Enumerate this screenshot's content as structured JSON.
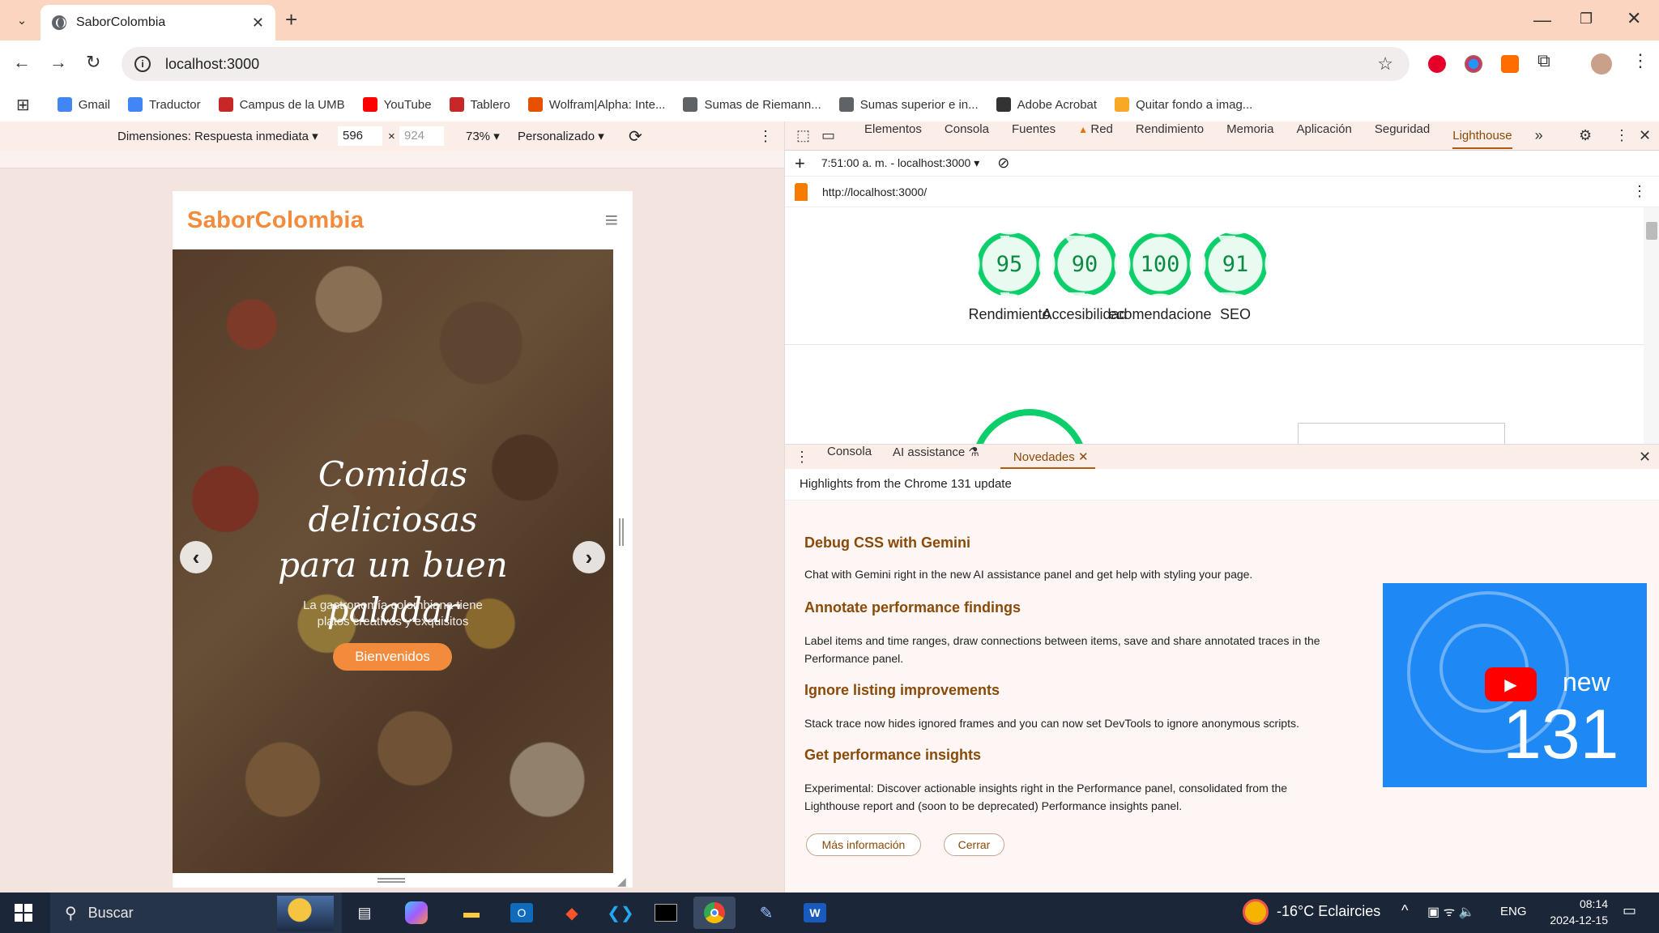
{
  "browser": {
    "tab_title": "SaborColombia",
    "url": "localhost:3000",
    "bookmarks": [
      {
        "label": "Gmail",
        "color": "#4285f4"
      },
      {
        "label": "Traductor",
        "color": "#4285f4"
      },
      {
        "label": "Campus de la UMB",
        "color": "#c62828"
      },
      {
        "label": "YouTube",
        "color": "#ff0000"
      },
      {
        "label": "Tablero",
        "color": "#c62828"
      },
      {
        "label": "Wolfram|Alpha: Inte...",
        "color": "#e65100"
      },
      {
        "label": "Sumas de Riemann...",
        "color": "#5f6368"
      },
      {
        "label": "Sumas superior e in...",
        "color": "#5f6368"
      },
      {
        "label": "Adobe Acrobat",
        "color": "#333333"
      },
      {
        "label": "Quitar fondo a imag...",
        "color": "#f9a825"
      }
    ]
  },
  "device_toolbar": {
    "dimensions_label": "Dimensiones: Respuesta inmediata",
    "width": "596",
    "height": "924",
    "zoom": "73%",
    "throttle": "Personalizado"
  },
  "site": {
    "logo": "SaborColombia",
    "hero_title": "Comidas deliciosas para un buen paladar",
    "hero_subtitle": "La gastronomía colombiana tiene platos creativos y exquisitos",
    "hero_button": "Bienvenidos"
  },
  "devtools": {
    "tabs": [
      "Elementos",
      "Consola",
      "Fuentes",
      "Red",
      "Rendimiento",
      "Memoria",
      "Aplicación",
      "Seguridad",
      "Lighthouse"
    ],
    "active_tab": "Lighthouse",
    "report_time": "7:51:00 a. m. - localhost:3000",
    "report_url": "http://localhost:3000/",
    "scores": [
      {
        "value": "95",
        "label": "Rendimiento",
        "fraction": 0.95
      },
      {
        "value": "90",
        "label": "Accesibilidad",
        "fraction": 0.9
      },
      {
        "value": "100",
        "label": "ecomendacione",
        "fraction": 1.0
      },
      {
        "value": "91",
        "label": "SEO",
        "fraction": 0.91
      }
    ],
    "drawer_tabs": [
      "Consola",
      "AI assistance",
      "Novedades"
    ],
    "drawer_active": "Novedades",
    "whats_new": {
      "intro": "Highlights from the Chrome 131 update",
      "items": [
        {
          "title": "Debug CSS with Gemini",
          "body": "Chat with Gemini right in the new AI assistance panel and get help with styling your page."
        },
        {
          "title": "Annotate performance findings",
          "body": "Label items and time ranges, draw connections between items, save and share annotated traces in the Performance panel."
        },
        {
          "title": "Ignore listing improvements",
          "body": "Stack trace now hides ignored frames and you can now set DevTools to ignore anonymous scripts."
        },
        {
          "title": "Get performance insights",
          "body": "Experimental: Discover actionable insights right in the Performance panel, consolidated from the Lighthouse report and (soon to be deprecated) Performance insights panel."
        }
      ],
      "promo_word": "new",
      "promo_number": "131",
      "more_button": "Más información",
      "close_button": "Cerrar"
    }
  },
  "taskbar": {
    "search_placeholder": "Buscar",
    "weather": "-16°C  Eclaircies",
    "language": "ENG",
    "time": "08:14",
    "date": "2024-12-15"
  }
}
